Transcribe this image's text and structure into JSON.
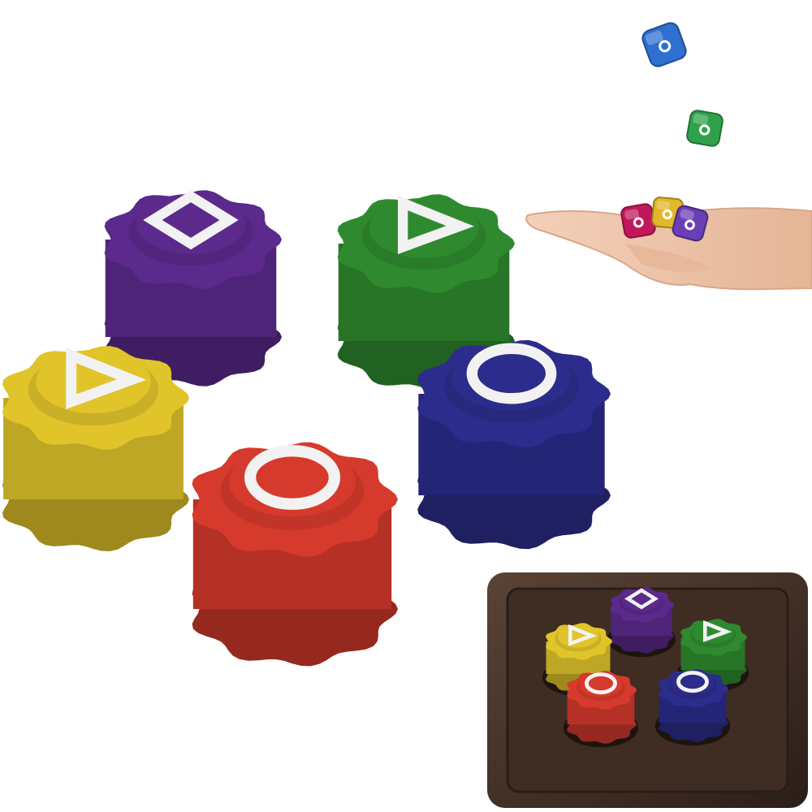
{
  "scene": {
    "background": "#ffffff",
    "pieces": [
      {
        "id": "purple",
        "color": "#5b2a8c",
        "symbol": "square"
      },
      {
        "id": "green",
        "color": "#2f8a2f",
        "symbol": "triangle"
      },
      {
        "id": "yellow",
        "color": "#e0c42a",
        "symbol": "triangle"
      },
      {
        "id": "blue",
        "color": "#2c2c8c",
        "symbol": "circle"
      },
      {
        "id": "red",
        "color": "#d63a2c",
        "symbol": "circle"
      }
    ],
    "symbol_color": "#f2f2f2",
    "tray": {
      "wood_color": "#3b2a22",
      "wood_light": "#5a4336"
    },
    "dice": [
      {
        "id": "blue-die",
        "color": "#2f6fd0"
      },
      {
        "id": "green-die",
        "color": "#2fa14a"
      },
      {
        "id": "magenta-die",
        "color": "#c2185b"
      },
      {
        "id": "yellow-die",
        "color": "#e2b72a"
      },
      {
        "id": "violet-die",
        "color": "#6a3fb5"
      }
    ],
    "hand_color": "#f2c7ad"
  }
}
